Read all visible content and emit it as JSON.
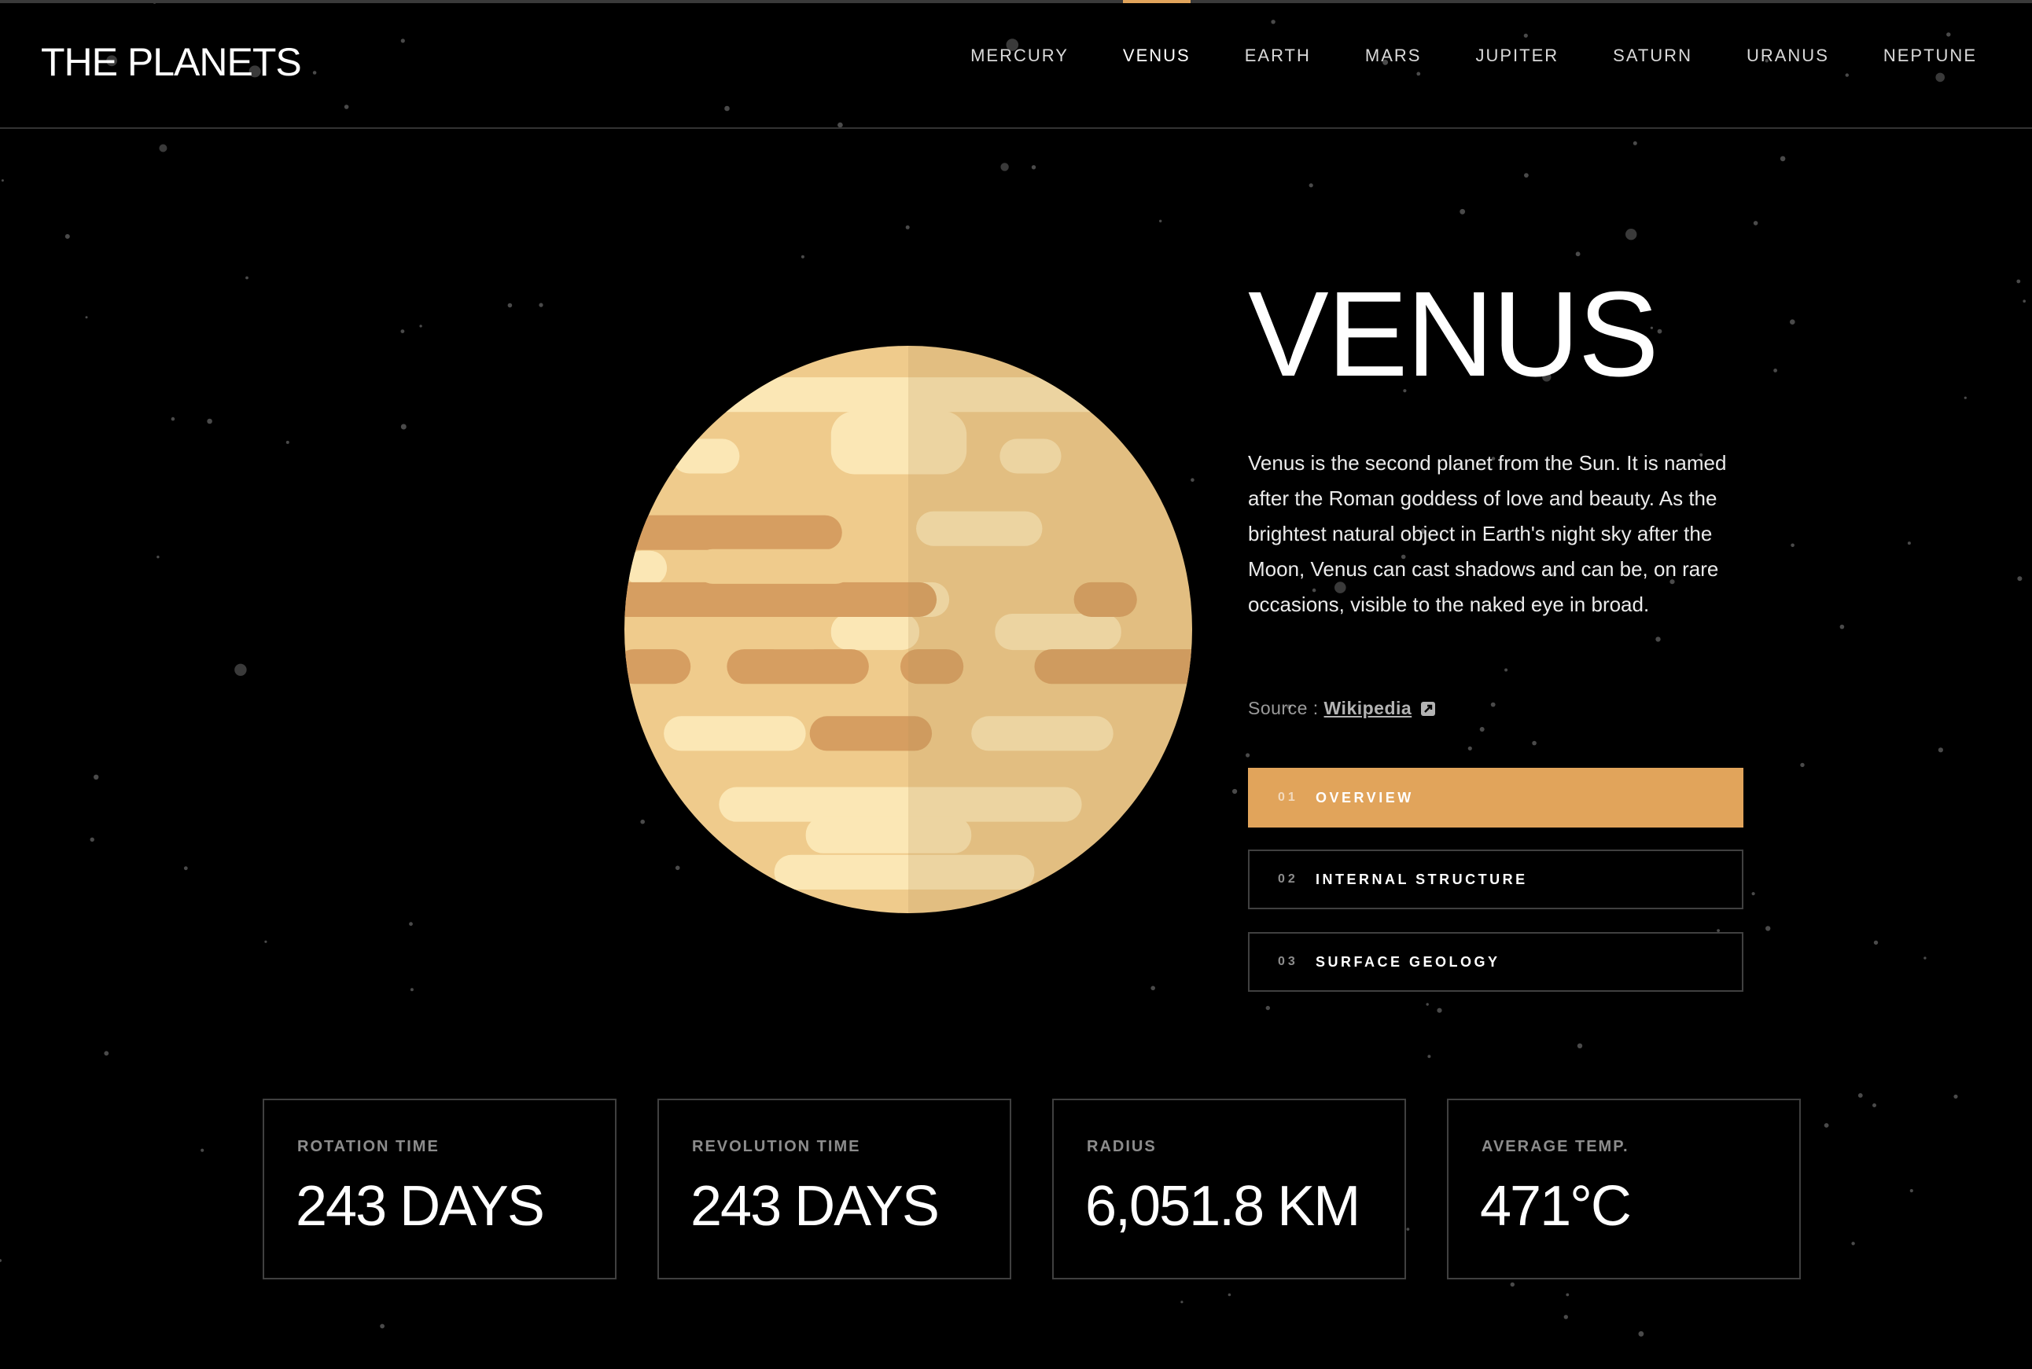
{
  "header": {
    "logo": "THE PLANETS",
    "nav": [
      {
        "label": "MERCURY",
        "active": false
      },
      {
        "label": "VENUS",
        "active": true
      },
      {
        "label": "EARTH",
        "active": false
      },
      {
        "label": "MARS",
        "active": false
      },
      {
        "label": "JUPITER",
        "active": false
      },
      {
        "label": "SATURN",
        "active": false
      },
      {
        "label": "URANUS",
        "active": false
      },
      {
        "label": "NEPTUNE",
        "active": false
      }
    ]
  },
  "planet": {
    "name": "VENUS",
    "description": "Venus is the second planet from the Sun. It is named after the Roman goddess of love and beauty. As the brightest natural object in Earth's night sky after the Moon, Venus can cast shadows and can be, on rare occasions, visible to the naked eye in broad.",
    "source_prefix": "Source : ",
    "source_link": "Wikipedia",
    "source_icon": "external-link-icon",
    "image_icon": "venus-planet-illustration"
  },
  "tabs": [
    {
      "num": "01",
      "label": "OVERVIEW",
      "active": true
    },
    {
      "num": "02",
      "label": "INTERNAL STRUCTURE",
      "active": false
    },
    {
      "num": "03",
      "label": "SURFACE GEOLOGY",
      "active": false
    }
  ],
  "stats": [
    {
      "label": "ROTATION TIME",
      "value": "243 DAYS"
    },
    {
      "label": "REVOLUTION TIME",
      "value": "243 DAYS"
    },
    {
      "label": "RADIUS",
      "value": "6,051.8 KM"
    },
    {
      "label": "AVERAGE TEMP.",
      "value": "471°C"
    }
  ],
  "colors": {
    "background": "#000000",
    "accent": "#e1a45b",
    "planet_base": "#efcb8c",
    "planet_light": "#fbe7b5",
    "planet_dark": "#d69e61",
    "planet_shade": "#dcbd7d"
  }
}
